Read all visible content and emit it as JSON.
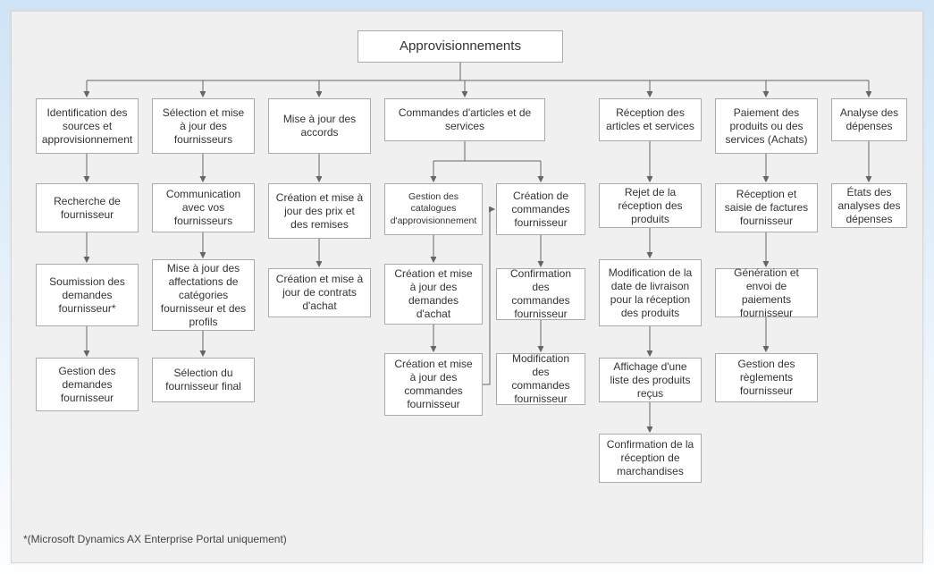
{
  "root": "Approvisionnements",
  "cols": {
    "c1": {
      "head": "Identification des sources et approvisionnement",
      "items": [
        "Recherche de fournisseur",
        "Soumission des demandes fournisseur*",
        "Gestion des demandes fournisseur"
      ]
    },
    "c2": {
      "head": "Sélection et mise à jour des fournisseurs",
      "items": [
        "Communication avec vos fournisseurs",
        "Mise à jour des affectations de catégories fournisseur et des profils",
        "Sélection du fournisseur final"
      ]
    },
    "c3": {
      "head": "Mise à jour des accords",
      "items": [
        "Création et mise à jour des prix et des remises",
        "Création et mise à jour de contrats d'achat"
      ]
    },
    "c4": {
      "head": "Commandes d'articles et de services",
      "left": [
        "Gestion des catalogues d'approvisionnement",
        "Création et mise à jour des demandes d'achat",
        "Création et mise à jour des commandes fournisseur"
      ],
      "right": [
        "Création de commandes fournisseur",
        "Confirmation des commandes fournisseur",
        "Modification des commandes fournisseur"
      ]
    },
    "c5": {
      "head": "Réception des articles et services",
      "items": [
        "Rejet de la réception des produits",
        "Modification de la date de livraison pour la réception des produits",
        "Affichage d'une liste des produits reçus",
        "Confirmation de la réception de marchandises"
      ]
    },
    "c6": {
      "head": "Paiement des produits ou des services (Achats)",
      "items": [
        "Réception et saisie de factures fournisseur",
        "Génération et envoi de paiements fournisseur",
        "Gestion des règlements fournisseur"
      ]
    },
    "c7": {
      "head": "Analyse des dépenses",
      "items": [
        "États des analyses des dépenses"
      ]
    }
  },
  "footnote": "*(Microsoft Dynamics AX Enterprise Portal uniquement)",
  "chart_data": {
    "type": "tree",
    "title": "Approvisionnements",
    "children": [
      {
        "name": "Identification des sources et approvisionnement",
        "children": [
          "Recherche de fournisseur",
          "Soumission des demandes fournisseur*",
          "Gestion des demandes fournisseur"
        ]
      },
      {
        "name": "Sélection et mise à jour des fournisseurs",
        "children": [
          "Communication avec vos fournisseurs",
          "Mise à jour des affectations de catégories fournisseur et des profils",
          "Sélection du fournisseur final"
        ]
      },
      {
        "name": "Mise à jour des accords",
        "children": [
          "Création et mise à jour des prix et des remises",
          "Création et mise à jour de contrats d'achat"
        ]
      },
      {
        "name": "Commandes d'articles et de services",
        "children": [
          {
            "branch": "catalogues",
            "chain": [
              "Gestion des catalogues d'approvisionnement",
              "Création et mise à jour des demandes d'achat",
              "Création et mise à jour des commandes fournisseur"
            ],
            "link_to": "Création de commandes fournisseur"
          },
          {
            "branch": "commandes",
            "chain": [
              "Création de commandes fournisseur",
              "Confirmation des commandes fournisseur",
              "Modification des commandes fournisseur"
            ]
          }
        ]
      },
      {
        "name": "Réception des articles et services",
        "children": [
          "Rejet de la réception des produits",
          "Modification de la date de livraison pour la réception des produits",
          "Affichage d'une liste des produits reçus",
          "Confirmation de la réception de marchandises"
        ]
      },
      {
        "name": "Paiement des produits ou des services (Achats)",
        "children": [
          "Réception et saisie de factures fournisseur",
          "Génération et envoi de paiements fournisseur",
          "Gestion des règlements fournisseur"
        ]
      },
      {
        "name": "Analyse des dépenses",
        "children": [
          "États des analyses des dépenses"
        ]
      }
    ],
    "footnote": "*(Microsoft Dynamics AX Enterprise Portal uniquement)"
  }
}
